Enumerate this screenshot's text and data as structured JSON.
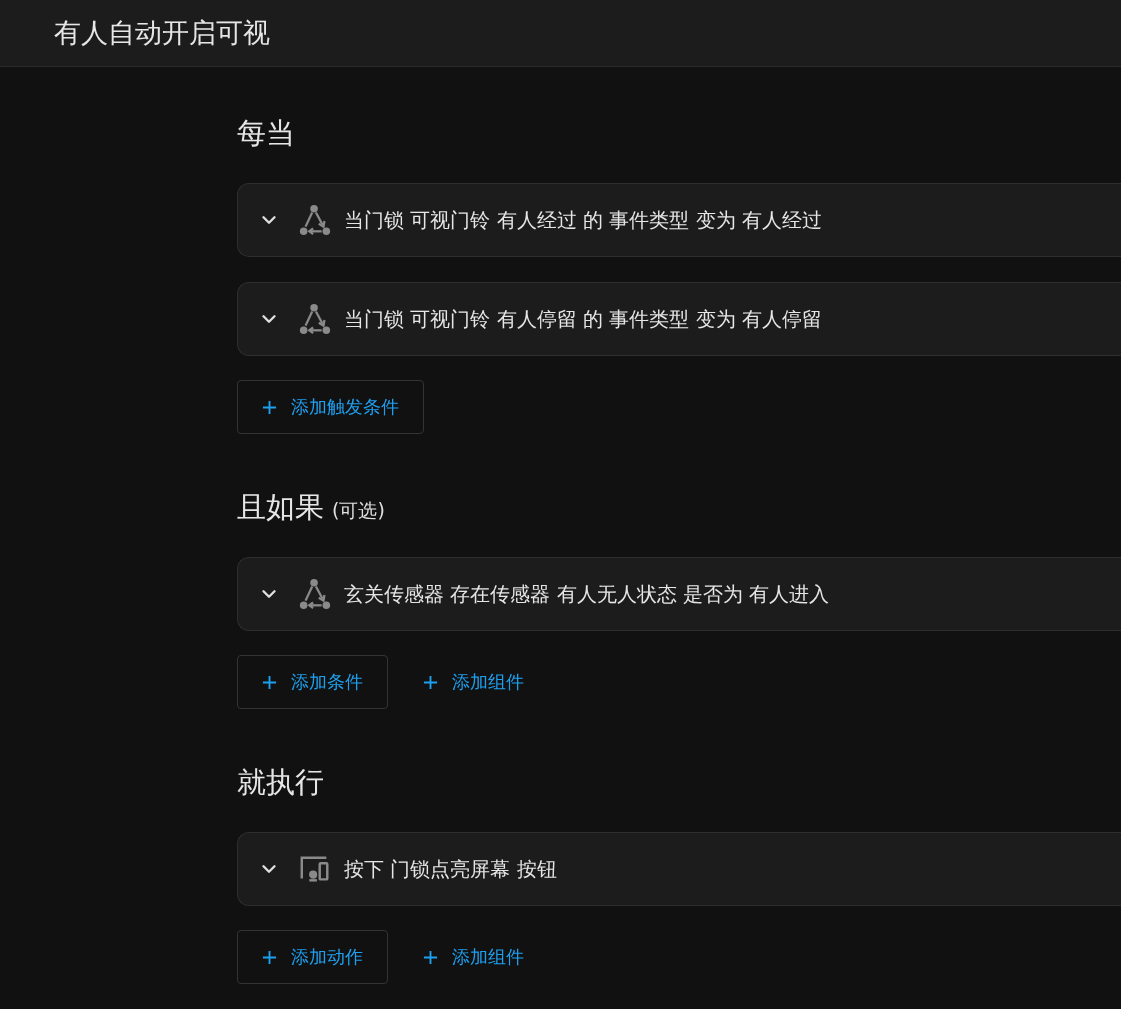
{
  "header": {
    "title": "有人自动开启可视"
  },
  "sections": [
    {
      "heading": "每当",
      "cards": [
        {
          "kind": "trigger",
          "text": "当门锁 可视门铃 有人经过 的 事件类型 变为 有人经过"
        },
        {
          "kind": "trigger",
          "text": "当门锁 可视门铃 有人停留 的 事件类型 变为 有人停留"
        }
      ],
      "buttons": [
        {
          "kind": "outlined",
          "label": "添加触发条件"
        }
      ]
    },
    {
      "heading": "且如果",
      "note": "(可选)",
      "cards": [
        {
          "kind": "trigger",
          "text": "玄关传感器 存在传感器 有人无人状态 是否为 有人进入"
        }
      ],
      "buttons": [
        {
          "kind": "outlined",
          "label": "添加条件"
        },
        {
          "kind": "text",
          "label": "添加组件"
        }
      ]
    },
    {
      "heading": "就执行",
      "cards": [
        {
          "kind": "device",
          "text": "按下 门锁点亮屏幕 按钮"
        }
      ],
      "buttons": [
        {
          "kind": "outlined",
          "label": "添加动作"
        },
        {
          "kind": "text",
          "label": "添加组件"
        }
      ]
    }
  ]
}
